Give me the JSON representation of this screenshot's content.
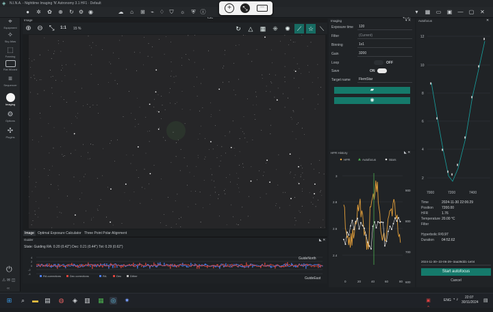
{
  "window": {
    "title": "N.I.N.A. - Nighttime Imaging 'N' Astronomy 3.1 HF1  ·  Default"
  },
  "toolbar": {
    "info_label": "Info",
    "tools_label": "Tools"
  },
  "sidebar": {
    "items": [
      {
        "label": "Equipment",
        "icon": "telescope-icon"
      },
      {
        "label": "Sky Atlas",
        "icon": "atlas-icon"
      },
      {
        "label": "Framing",
        "icon": "framing-icon"
      },
      {
        "label": "Flat Wizard",
        "icon": "flat-wizard-icon"
      },
      {
        "label": "Sequencer",
        "icon": "sequencer-icon"
      },
      {
        "label": "Imaging",
        "icon": "imaging-icon"
      },
      {
        "label": "Options",
        "icon": "options-icon"
      },
      {
        "label": "Plugins",
        "icon": "plugins-icon"
      }
    ]
  },
  "image_panel": {
    "title": "Image",
    "zoom_label": "1:1",
    "zoom_percent": "15 %"
  },
  "bottom_tabs": [
    "Image",
    "Optimal Exposure Calculator",
    "Three Point Polar Alignment"
  ],
  "guider": {
    "title": "Guider",
    "status": "State: Guiding  RA: 0.20 (0.42\")  Dec: 0.21 (0.44\")  Tot: 0.29 (0.62\")",
    "north_label": "GuideNorth",
    "east_label": "GuideEast",
    "legend": [
      "RA corrections",
      "Dec corrections",
      "RA",
      "Dec",
      "Dither"
    ],
    "y_ticks": [
      "4",
      "2",
      "0",
      "-2",
      "-4"
    ],
    "colors": {
      "ra": "#4a7df0",
      "dec": "#e0453d"
    }
  },
  "imaging": {
    "title": "Imaging",
    "fields": [
      {
        "label": "Exposure time",
        "value": "120"
      },
      {
        "label": "Filter",
        "value": "(Current)"
      },
      {
        "label": "Binning",
        "value": "1x1"
      },
      {
        "label": "Gain",
        "value": "3200"
      },
      {
        "label": "Loop",
        "value": "OFF"
      },
      {
        "label": "Save",
        "value": "ON"
      },
      {
        "label": "Target name",
        "value": "FlemStar"
      }
    ]
  },
  "hfr_history": {
    "title": "HFR History",
    "legend": [
      "HFR",
      "Autofocus",
      "Stars"
    ],
    "y_left": [
      "3",
      "2.8",
      "2.6",
      "2.4"
    ],
    "y_right": [
      "900",
      "800",
      "700",
      "600"
    ],
    "x_ticks": [
      "0",
      "20",
      "40",
      "60",
      "80"
    ],
    "colors": {
      "hfr": "#e8a23a",
      "stars": "#e6e6e6",
      "autofocus": "#4caf50"
    }
  },
  "autofocus": {
    "title": "Autofocus",
    "y_ticks": [
      "12",
      "10",
      "8",
      "6",
      "4",
      "2"
    ],
    "x_ticks": [
      "7000",
      "7200",
      "7400"
    ],
    "info": [
      {
        "label": "Time",
        "value": "2024-11-30 22:06:29"
      },
      {
        "label": "Position",
        "value": "7200.00"
      },
      {
        "label": "HFR",
        "value": "1.76"
      },
      {
        "label": "Temperature",
        "value": "20.00 °C"
      },
      {
        "label": "Filter",
        "value": ""
      },
      {
        "label": "Hyperbolic R²",
        "value": "0.97"
      },
      {
        "label": "Duration",
        "value": "04:52.62"
      }
    ],
    "run_select": "2024-11-30--22-06-29--3aa39dd1-1e04",
    "start_label": "Start autofocus",
    "cancel_label": "Cancel"
  },
  "taskbar": {
    "time": "22:07",
    "date": "30/11/2024",
    "lang": "ENG"
  }
}
